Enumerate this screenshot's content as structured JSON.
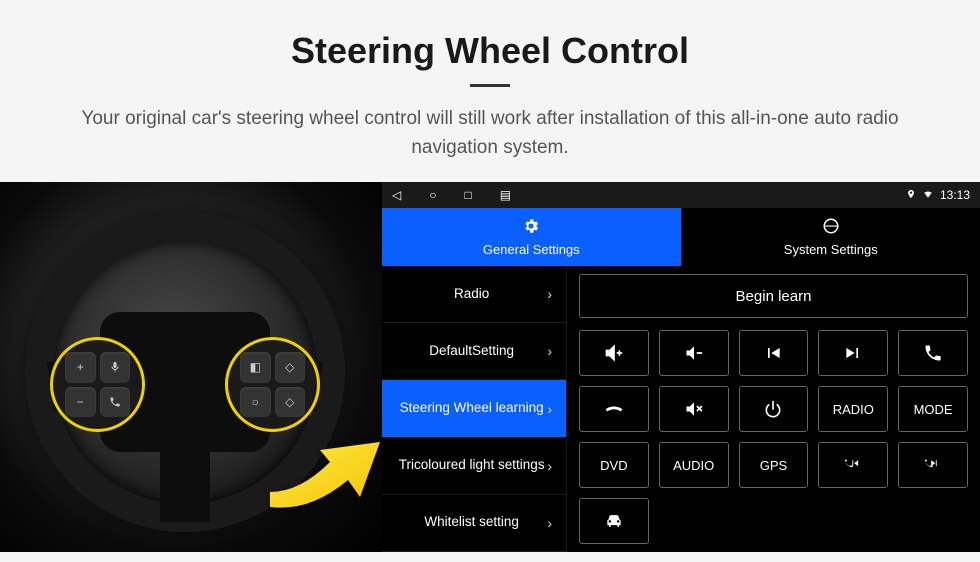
{
  "header": {
    "title": "Steering Wheel Control",
    "subtitle": "Your original car's steering wheel control will still work after installation of this all-in-one auto radio navigation system."
  },
  "navbar": {
    "time": "13:13"
  },
  "tabs": {
    "general": "General Settings",
    "system": "System Settings"
  },
  "menu": {
    "items": [
      "Radio",
      "DefaultSetting",
      "Steering Wheel learning",
      "Tricoloured light settings",
      "Whitelist setting"
    ],
    "activeIndex": 2
  },
  "panel": {
    "beginLearn": "Begin learn",
    "buttons": {
      "volUp": "vol-up",
      "volDown": "vol-down",
      "prev": "prev-track",
      "next": "next-track",
      "call": "call",
      "hangup": "hang-up",
      "mute": "mute",
      "power": "power",
      "radio": "RADIO",
      "mode": "MODE",
      "dvd": "DVD",
      "audio": "AUDIO",
      "gps": "GPS",
      "callPrev": "call-prev",
      "callNext": "call-next",
      "car": "car"
    }
  },
  "wheelButtons": {
    "left": [
      "+",
      "voice",
      "−",
      "phone"
    ],
    "right": [
      "menu",
      "up",
      "select",
      "down"
    ]
  }
}
